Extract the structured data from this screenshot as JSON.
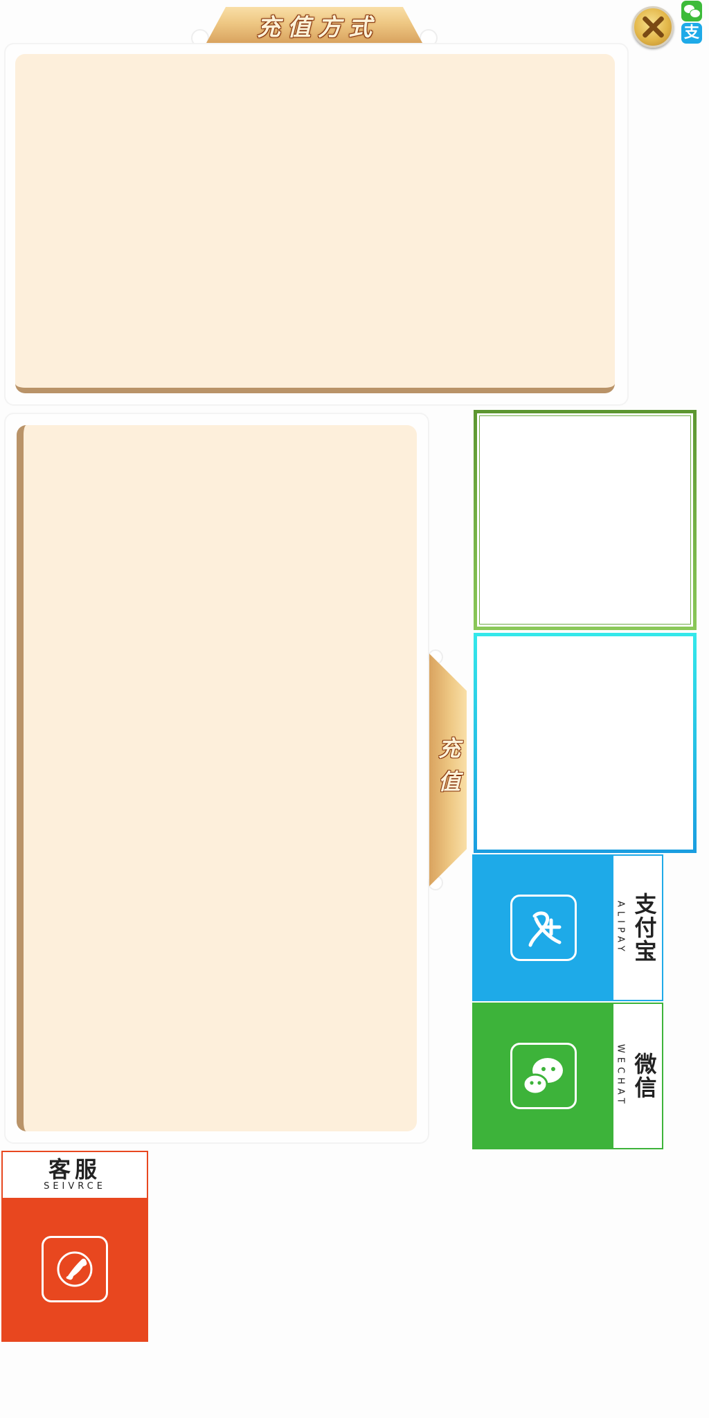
{
  "header": {
    "title": "充值方式"
  },
  "side_tab": {
    "label": "充值"
  },
  "payment_options": {
    "alipay": {
      "name_cn": "支付宝",
      "name_en": "ALIPAY",
      "icon": "alipay-icon",
      "color": "#1eaae8"
    },
    "wechat": {
      "name_cn": "微信",
      "name_en": "WECHAT",
      "icon": "wechat-icon",
      "color": "#3db33a"
    }
  },
  "service": {
    "name_cn": "客服",
    "name_en": "SEIVRCE",
    "icon": "phone-icon",
    "color": "#e8471f"
  },
  "corner_icons": {
    "wechat": "wechat-mini-icon",
    "alipay": "alipay-mini-icon",
    "alipay_glyph": "支"
  },
  "close": {
    "icon": "close-icon"
  },
  "colors": {
    "panel_fill": "#fdefdb",
    "panel_edge": "#b99368",
    "tab_gold": "#eec783"
  }
}
